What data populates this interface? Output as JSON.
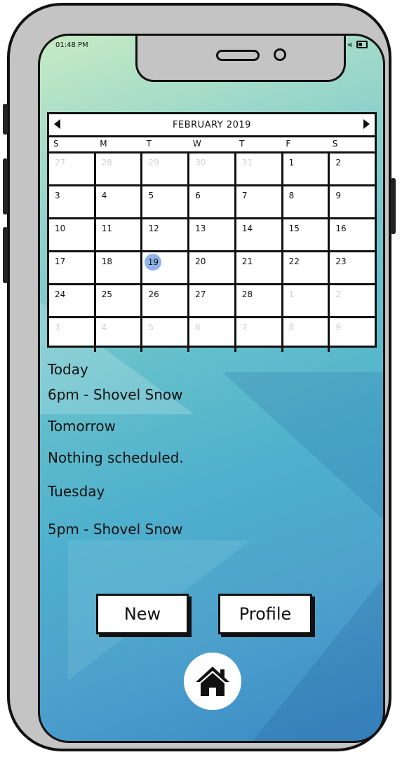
{
  "status_bar": {
    "time": "01:48 PM"
  },
  "calendar": {
    "month_label": "FEBRUARY 2019",
    "weekdays": [
      "S",
      "M",
      "T",
      "W",
      "T",
      "F",
      "S"
    ],
    "weeks": [
      [
        {
          "d": "27",
          "m": true
        },
        {
          "d": "28",
          "m": true
        },
        {
          "d": "29",
          "m": true
        },
        {
          "d": "30",
          "m": true
        },
        {
          "d": "31",
          "m": true
        },
        {
          "d": "1"
        },
        {
          "d": "2"
        }
      ],
      [
        {
          "d": "3"
        },
        {
          "d": "4"
        },
        {
          "d": "5"
        },
        {
          "d": "6"
        },
        {
          "d": "7"
        },
        {
          "d": "8"
        },
        {
          "d": "9"
        }
      ],
      [
        {
          "d": "10"
        },
        {
          "d": "11"
        },
        {
          "d": "12"
        },
        {
          "d": "13"
        },
        {
          "d": "14"
        },
        {
          "d": "15"
        },
        {
          "d": "16"
        }
      ],
      [
        {
          "d": "17"
        },
        {
          "d": "18"
        },
        {
          "d": "19",
          "today": true
        },
        {
          "d": "20"
        },
        {
          "d": "21"
        },
        {
          "d": "22"
        },
        {
          "d": "23"
        }
      ],
      [
        {
          "d": "24"
        },
        {
          "d": "25"
        },
        {
          "d": "26"
        },
        {
          "d": "27"
        },
        {
          "d": "28"
        },
        {
          "d": "1",
          "m": true
        },
        {
          "d": "2",
          "m": true
        }
      ],
      [
        {
          "d": "3",
          "m": true
        },
        {
          "d": "4",
          "m": true
        },
        {
          "d": "5",
          "m": true
        },
        {
          "d": "6",
          "m": true
        },
        {
          "d": "7",
          "m": true
        },
        {
          "d": "8",
          "m": true
        },
        {
          "d": "9",
          "m": true
        }
      ]
    ],
    "selected_color": "#8fb4ea"
  },
  "agenda": {
    "today_label": "Today",
    "today_event": "6pm - Shovel Snow",
    "tomorrow_label": "Tomorrow",
    "tomorrow_event": "Nothing scheduled.",
    "tuesday_label": "Tuesday",
    "tuesday_event": "5pm - Shovel Snow"
  },
  "buttons": {
    "new_label": "New",
    "profile_label": "Profile"
  },
  "icons": {
    "home": "home-icon",
    "prev": "chevron-left-icon",
    "next": "chevron-right-icon",
    "signal": "cell-signal-icon",
    "wifi": "wifi-icon",
    "battery": "battery-icon"
  }
}
